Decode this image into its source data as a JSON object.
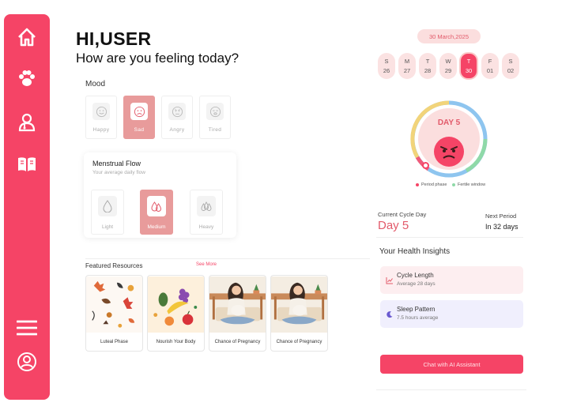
{
  "greeting": {
    "title": "HI,USER",
    "subtitle": "How are you feeling today?"
  },
  "sidebar": {
    "items": [
      {
        "icon": "home-icon"
      },
      {
        "icon": "paw-icon"
      },
      {
        "icon": "doctor-icon"
      },
      {
        "icon": "book-icon"
      }
    ],
    "bottom": [
      {
        "icon": "menu-icon"
      },
      {
        "icon": "profile-icon"
      }
    ]
  },
  "mood": {
    "label": "Mood",
    "options": [
      {
        "label": "Happy",
        "icon": "happy-face-icon",
        "selected": false
      },
      {
        "label": "Sad",
        "icon": "sad-face-icon",
        "selected": true
      },
      {
        "label": "Angry",
        "icon": "angry-face-icon",
        "selected": false
      },
      {
        "label": "Tired",
        "icon": "tired-face-icon",
        "selected": false
      }
    ]
  },
  "flow": {
    "title": "Menstrual Flow",
    "subtitle": "Your average daily flow",
    "options": [
      {
        "label": "Light",
        "icon": "single-drop-icon",
        "selected": false
      },
      {
        "label": "Medium",
        "icon": "double-drop-icon",
        "selected": true
      },
      {
        "label": "Heavy",
        "icon": "triple-drop-icon",
        "selected": false
      }
    ]
  },
  "resources": {
    "title": "Featured Resources",
    "see_more": "See More",
    "items": [
      {
        "label": "Luteal Phase"
      },
      {
        "label": "Nourish Your Body"
      },
      {
        "label": "Chance of Pregnancy"
      },
      {
        "label": "Chance of Pregnancy"
      }
    ]
  },
  "calendar": {
    "date": "30 March,2025",
    "days": [
      {
        "dow": "S",
        "num": "26",
        "active": false
      },
      {
        "dow": "M",
        "num": "27",
        "active": false
      },
      {
        "dow": "T",
        "num": "28",
        "active": false
      },
      {
        "dow": "W",
        "num": "29",
        "active": false
      },
      {
        "dow": "T",
        "num": "30",
        "active": true
      },
      {
        "dow": "F",
        "num": "01",
        "active": false
      },
      {
        "dow": "S",
        "num": "02",
        "active": false
      }
    ]
  },
  "cycle": {
    "day_label": "DAY 5",
    "legend": [
      {
        "label": "Period phase",
        "color": "#f54466"
      },
      {
        "label": "Fertile window",
        "color": "#8fd9a8"
      }
    ],
    "current_label": "Current Cycle Day",
    "current_value": "Day 5",
    "next_label": "Next Period",
    "next_value": "In 32 days"
  },
  "insights": {
    "title": "Your Health Insights",
    "items": [
      {
        "title": "Cycle Length",
        "subtitle": "Average 28 days",
        "icon": "chart-icon",
        "bg": "#fdeef0"
      },
      {
        "title": "Sleep Pattern",
        "subtitle": "7.5 hours average",
        "icon": "moon-icon",
        "bg": "#f0effd"
      }
    ]
  },
  "chat_button": "Chat with AI Assistant",
  "colors": {
    "accent": "#f54466",
    "selected": "#e89b9b",
    "pale": "#fbdede"
  }
}
